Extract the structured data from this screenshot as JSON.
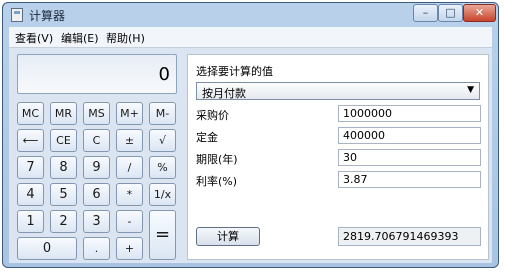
{
  "window": {
    "title": "计算器",
    "controls": {
      "minimize": "–",
      "maximize": "□",
      "close": "✕"
    }
  },
  "menu": [
    "查看(V)",
    "编辑(E)",
    "帮助(H)"
  ],
  "display": {
    "value": "0"
  },
  "keys": [
    [
      "MC",
      "MR",
      "MS",
      "M+",
      "M-"
    ],
    [
      "⟵",
      "CE",
      "C",
      "±",
      "√"
    ],
    [
      "7",
      "8",
      "9",
      "/",
      "%"
    ],
    [
      "4",
      "5",
      "6",
      "*",
      "1/x"
    ],
    [
      "1",
      "2",
      "3",
      "-",
      "="
    ],
    [
      "0",
      ".",
      "+"
    ]
  ],
  "form": {
    "heading": "选择要计算的值",
    "select_value": "按月付款",
    "fields": [
      {
        "label": "采购价",
        "value": "1000000"
      },
      {
        "label": "定金",
        "value": "400000"
      },
      {
        "label": "期限(年)",
        "value": "30"
      },
      {
        "label": "利率(%)",
        "value": "3.87"
      }
    ],
    "calculate_label": "计算",
    "result": "2819.706791469393"
  }
}
